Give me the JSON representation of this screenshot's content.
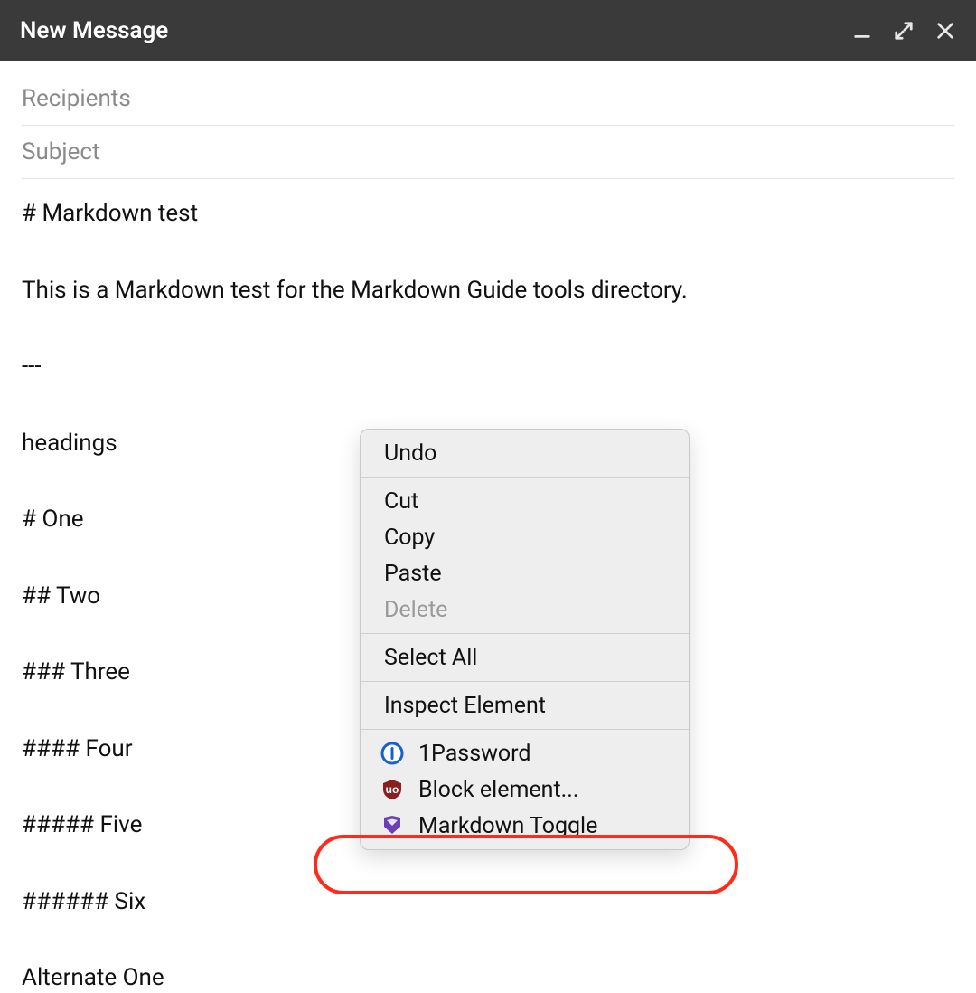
{
  "titlebar": {
    "title": "New Message"
  },
  "fields": {
    "recipients_placeholder": "Recipients",
    "subject_placeholder": "Subject"
  },
  "body_lines": [
    "# Markdown test",
    "This is a Markdown test for the Markdown Guide tools directory.",
    "---",
    "headings",
    "# One",
    "## Two",
    "### Three",
    "#### Four",
    "##### Five",
    "###### Six",
    "Alternate One"
  ],
  "context_menu": {
    "undo": "Undo",
    "cut": "Cut",
    "copy": "Copy",
    "paste": "Paste",
    "delete": "Delete",
    "select_all": "Select All",
    "inspect": "Inspect Element",
    "ext_1password": "1Password",
    "ext_block_element": "Block element...",
    "ext_markdown_toggle": "Markdown Toggle"
  }
}
